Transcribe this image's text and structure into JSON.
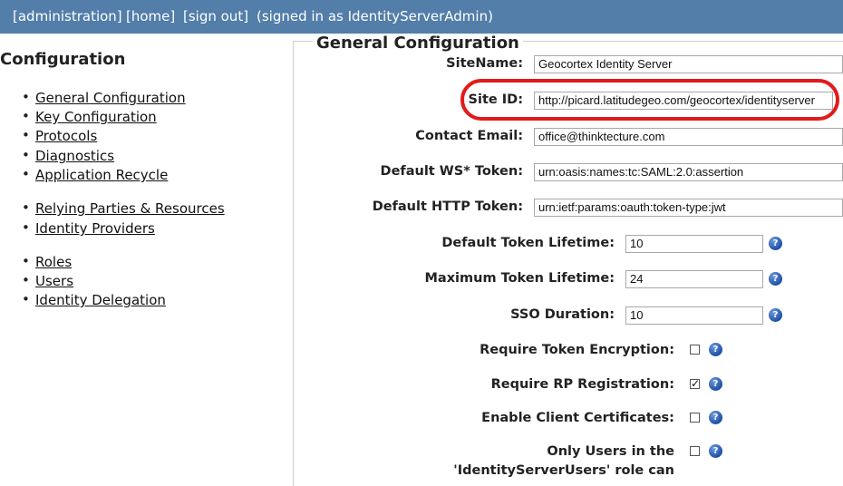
{
  "topbar": {
    "administration": "[administration]",
    "home": "[home]",
    "sign_out": "[sign out]",
    "signed_in": "(signed in as IdentityServerAdmin)"
  },
  "sidebar": {
    "title": "Configuration",
    "items": [
      {
        "label": "General Configuration"
      },
      {
        "label": "Key Configuration"
      },
      {
        "label": "Protocols"
      },
      {
        "label": "Diagnostics"
      },
      {
        "label": "Application Recycle"
      },
      {
        "label": "Relying Parties & Resources"
      },
      {
        "label": "Identity Providers"
      },
      {
        "label": "Roles"
      },
      {
        "label": "Users"
      },
      {
        "label": "Identity Delegation"
      }
    ]
  },
  "main": {
    "legend": "General Configuration",
    "fields": {
      "site_name": {
        "label": "SiteName:",
        "value": "Geocortex Identity Server"
      },
      "site_id": {
        "label": "Site ID:",
        "value": "http://picard.latitudegeo.com/geocortex/identityserver"
      },
      "contact_email": {
        "label": "Contact Email:",
        "value": "office@thinktecture.com"
      },
      "default_ws_token": {
        "label": "Default WS* Token:",
        "value": "urn:oasis:names:tc:SAML:2.0:assertion"
      },
      "default_http_token": {
        "label": "Default HTTP Token:",
        "value": "urn:ietf:params:oauth:token-type:jwt"
      },
      "default_token_lifetime": {
        "label": "Default Token Lifetime:",
        "value": "10"
      },
      "maximum_token_lifetime": {
        "label": "Maximum Token Lifetime:",
        "value": "24"
      },
      "sso_duration": {
        "label": "SSO Duration:",
        "value": "10"
      }
    },
    "checks": {
      "require_token_encryption": {
        "label": "Require Token Encryption:",
        "checked": false,
        "mark": ""
      },
      "require_rp_registration": {
        "label": "Require RP Registration:",
        "checked": true,
        "mark": "✓"
      },
      "enable_client_certificates": {
        "label": "Enable Client Certificates:",
        "checked": false,
        "mark": ""
      },
      "only_users_in_role": {
        "label_line1": "Only Users in the",
        "label_line2": "'IdentityServerUsers' role can",
        "checked": false,
        "mark": ""
      }
    },
    "help_glyph": "?",
    "highlight_color": "#e01b1b"
  }
}
